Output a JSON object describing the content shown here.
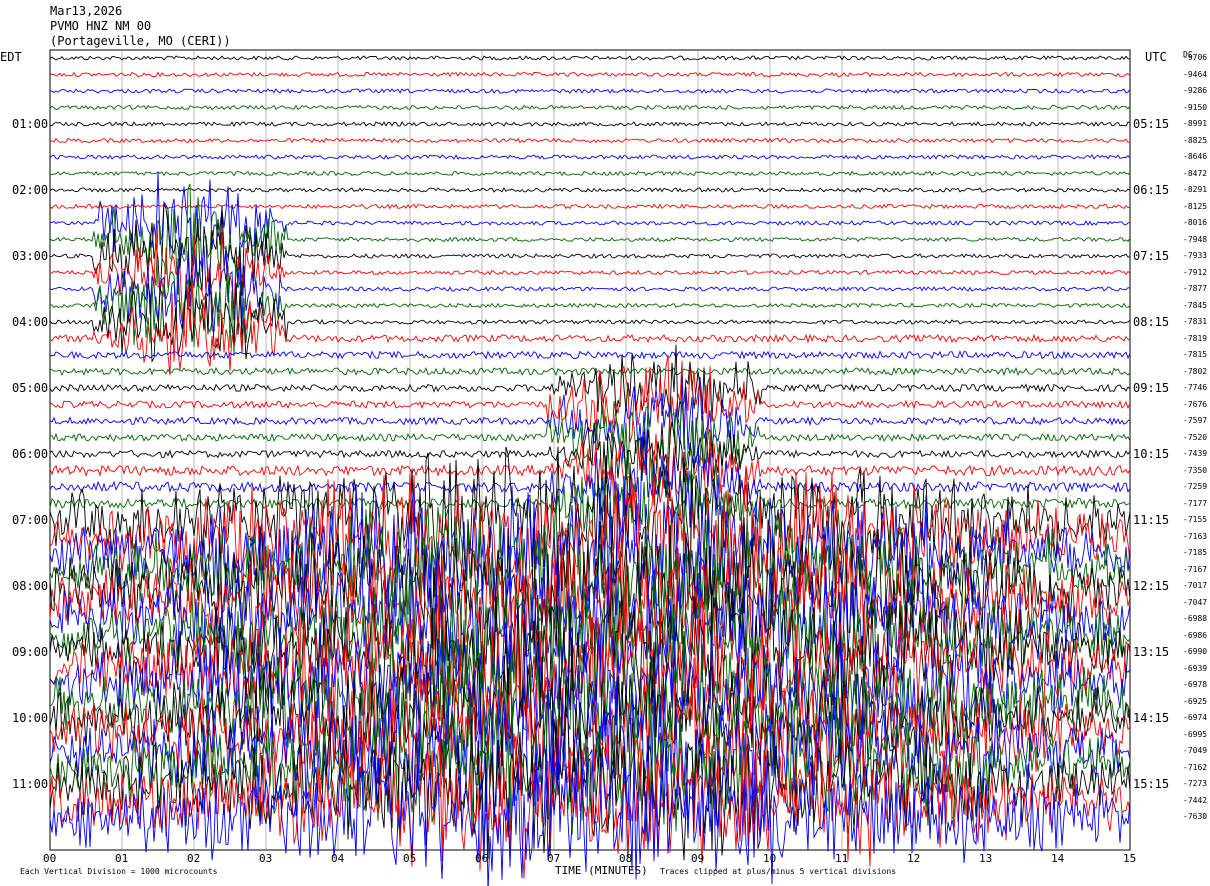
{
  "header": {
    "date": "Mar13,2026",
    "station": "PVMO HNZ NM 00",
    "location": "(Portageville, MO (CERI))"
  },
  "left_zone": "EDT",
  "right_zone": "UTC",
  "dc_label": "DC",
  "footer": {
    "scale_note": "Each Vertical Division = 1000 microcounts",
    "x_axis_title": "TIME (MINUTES)",
    "clip_note": "Traces clipped at plus/minus 5 vertical divisions"
  },
  "chart_data": {
    "type": "line",
    "xlabel": "TIME (MINUTES)",
    "xlim": [
      0,
      15
    ],
    "x_ticks": [
      "00",
      "01",
      "02",
      "03",
      "04",
      "05",
      "06",
      "07",
      "08",
      "09",
      "10",
      "11",
      "12",
      "13",
      "14",
      "15"
    ],
    "trace_minutes": 15,
    "trace_colors": [
      "#000000",
      "#ff0000",
      "#0000ff",
      "#006400"
    ],
    "left_time_labels": [
      "01:00",
      "02:00",
      "03:00",
      "04:00",
      "05:00",
      "06:00",
      "07:00",
      "08:00",
      "09:00",
      "10:00",
      "11:00"
    ],
    "right_time_labels": [
      "05:15",
      "06:15",
      "07:15",
      "08:15",
      "09:15",
      "10:15",
      "11:15",
      "12:15",
      "13:15",
      "14:15",
      "15:15"
    ],
    "dc_offsets": [
      "-9706",
      "-9464",
      "-9286",
      "-9150",
      "-8991",
      "-8825",
      "-8646",
      "-8472",
      "-8291",
      "-8125",
      "-8016",
      "-7948",
      "-7933",
      "-7912",
      "-7877",
      "-7845",
      "-7831",
      "-7819",
      "-7815",
      "-7802",
      "-7746",
      "-7676",
      "-7597",
      "-7520",
      "-7439",
      "-7350",
      "-7259",
      "-7177",
      "-7155",
      "-7163",
      "-7185",
      "-7167",
      "-7017",
      "-7047",
      "-6988",
      "-6986",
      "-6990",
      "-6939",
      "-6978",
      "-6925",
      "-6974",
      "-6995",
      "-7049",
      "-7162",
      "-7273",
      "-7442",
      "-7630"
    ]
  }
}
